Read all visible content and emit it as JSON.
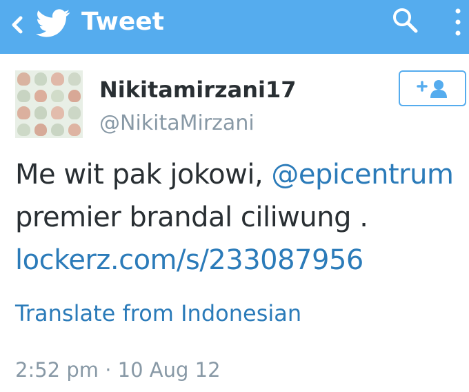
{
  "appbar": {
    "title": "Tweet",
    "color": "#55acee",
    "icons": [
      "back-chevron-icon",
      "twitter-bird-icon",
      "search-icon",
      "overflow-menu-icon"
    ]
  },
  "tweet": {
    "display_name": "Nikitamirzani17",
    "screen_name": "@NikitaMirzani",
    "text_line1_plain": "Me wit pak jokowi, ",
    "mention": "@epicentrum",
    "text_line2": "premier brandal ciliwung .",
    "link": "lockerz.com/s/233087956",
    "translate": "Translate from Indonesian",
    "timestamp": "2:52 pm · 10 Aug 12"
  },
  "follow_button": {
    "icon": "add-user-icon"
  },
  "colors": {
    "link": "#2b7bb9",
    "text": "#292f33",
    "muted": "#8899a6"
  }
}
